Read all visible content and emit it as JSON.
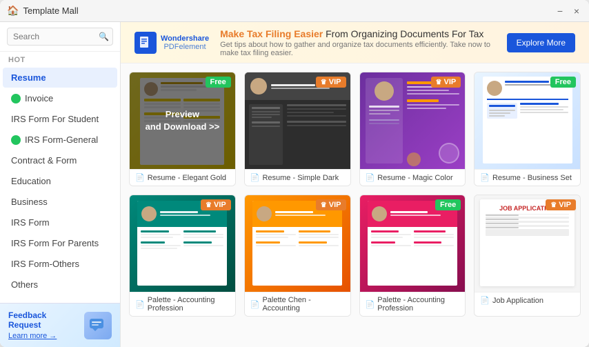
{
  "window": {
    "title": "Template Mall"
  },
  "titlebar": {
    "title": "Template Mall",
    "minimize_label": "−",
    "close_label": "×"
  },
  "sidebar": {
    "search_placeholder": "Search",
    "section_hot": "HOT",
    "nav_items": [
      {
        "id": "resume",
        "label": "Resume",
        "active": true,
        "dot_color": null
      },
      {
        "id": "invoice",
        "label": "Invoice",
        "active": false,
        "dot_color": "#22c55e"
      },
      {
        "id": "irs-student",
        "label": "IRS Form For Student",
        "active": false,
        "dot_color": null
      },
      {
        "id": "irs-general",
        "label": "IRS Form-General",
        "active": false,
        "dot_color": "#22c55e"
      },
      {
        "id": "contract",
        "label": "Contract & Form",
        "active": false,
        "dot_color": null
      },
      {
        "id": "education",
        "label": "Education",
        "active": false,
        "dot_color": null
      },
      {
        "id": "business",
        "label": "Business",
        "active": false,
        "dot_color": null
      },
      {
        "id": "irs-form",
        "label": "IRS Form",
        "active": false,
        "dot_color": null
      },
      {
        "id": "irs-parents",
        "label": "IRS Form For Parents",
        "active": false,
        "dot_color": null
      },
      {
        "id": "irs-others",
        "label": "IRS Form-Others",
        "active": false,
        "dot_color": null
      },
      {
        "id": "others",
        "label": "Others",
        "active": false,
        "dot_color": null
      }
    ],
    "feedback": {
      "title": "Feedback Request",
      "link_label": "Learn more →"
    }
  },
  "banner": {
    "logo_top": "Wondershare",
    "logo_bottom": "PDFelement",
    "headline_prefix": "",
    "headline_em": "Make Tax Filing Easier",
    "headline_suffix": " From Organizing Documents For Tax",
    "sub": "Get tips about how to gather and organize tax documents efficiently. Take now to make tax filing easier.",
    "btn_label": "Explore More"
  },
  "templates": [
    {
      "id": "elegant-gold",
      "label": "Resume - Elegant Gold",
      "badge": "Free",
      "badge_type": "free",
      "bg_class": "bg-yellow-pattern",
      "has_overlay": true,
      "overlay_text": "Preview\nand Download >>"
    },
    {
      "id": "simple-dark",
      "label": "Resume - Simple Dark",
      "badge": "VIP",
      "badge_type": "vip",
      "bg_class": "bg-dark-resume",
      "has_overlay": false
    },
    {
      "id": "magic-color",
      "label": "Resume - Magic Color",
      "badge": "VIP",
      "badge_type": "vip",
      "bg_class": "bg-purple-resume",
      "has_overlay": false
    },
    {
      "id": "business-set",
      "label": "Resume - Business Set",
      "badge": "Free",
      "badge_type": "free",
      "bg_class": "bg-blue-light",
      "has_overlay": false
    },
    {
      "id": "palette-teal",
      "label": "Palette - Accounting Profession",
      "badge": "VIP",
      "badge_type": "vip",
      "bg_class": "teal-card-bg",
      "has_overlay": false
    },
    {
      "id": "palette-orange",
      "label": "Palette Chen - Accounting",
      "badge": "VIP",
      "badge_type": "vip",
      "bg_class": "orange-card-bg",
      "has_overlay": false
    },
    {
      "id": "palette-free",
      "label": "Palette - Accounting Profession",
      "badge": "Free",
      "badge_type": "free",
      "bg_class": "pink-card-bg",
      "has_overlay": false
    },
    {
      "id": "job-application",
      "label": "Job Application",
      "badge": "VIP",
      "badge_type": "vip",
      "bg_class": "bg-job-app",
      "has_overlay": false
    }
  ]
}
